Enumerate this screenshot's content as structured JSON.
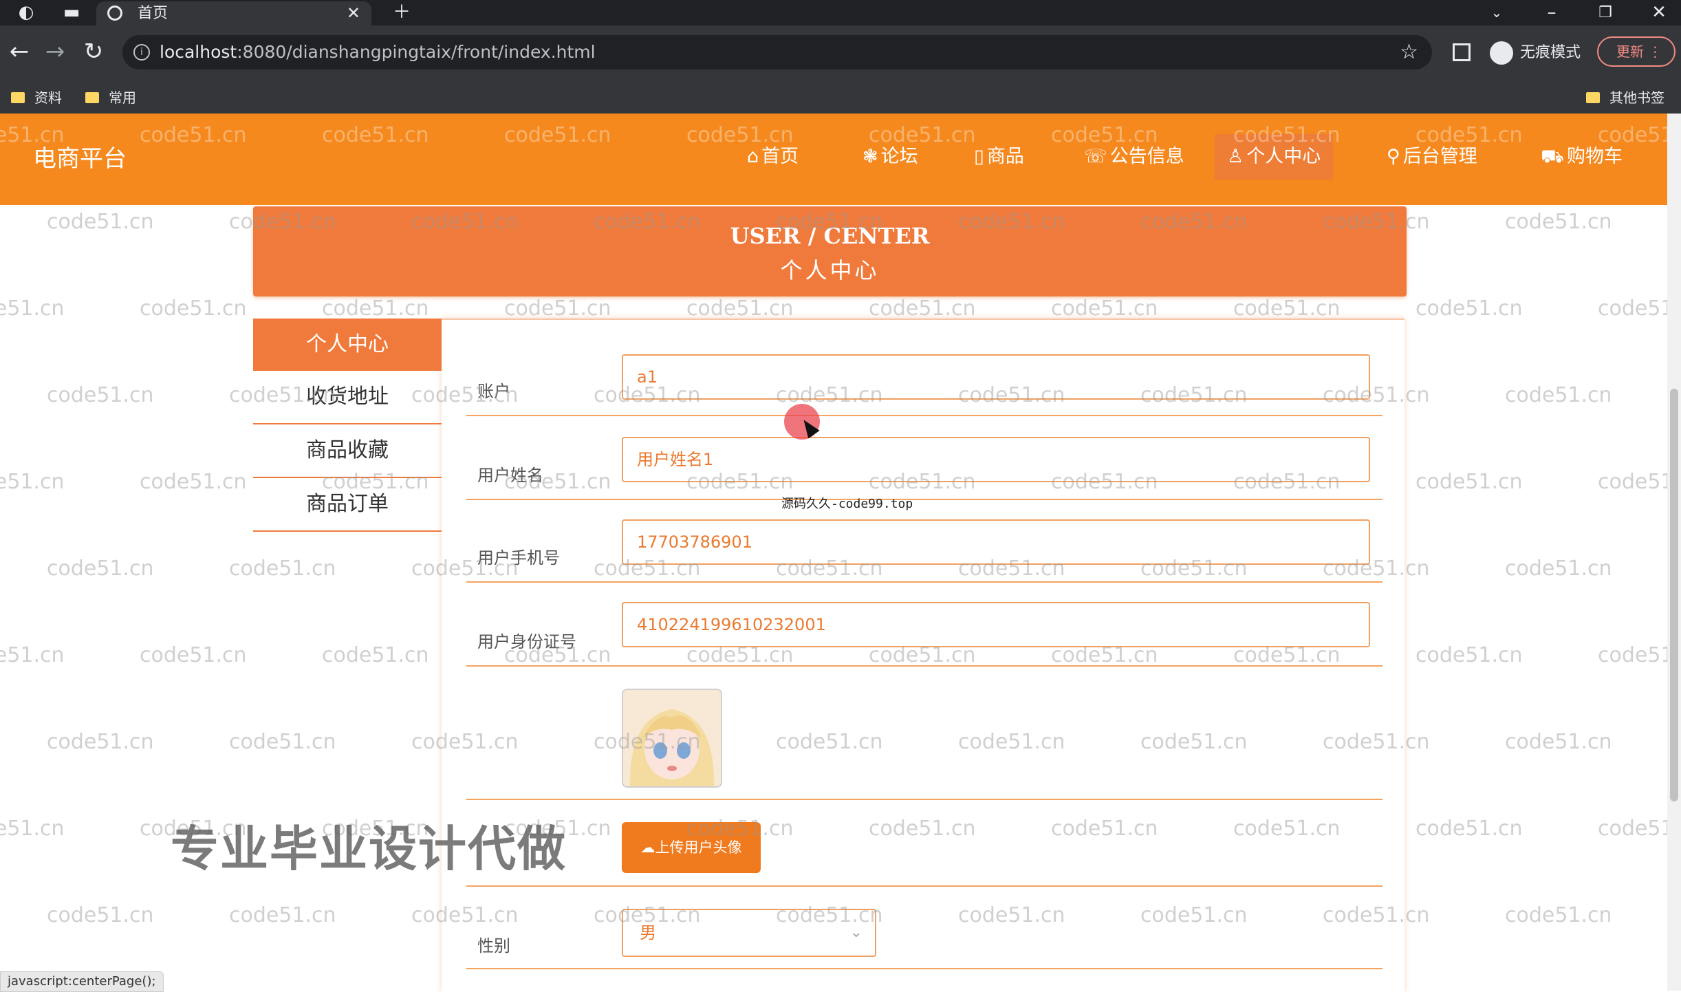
{
  "browser": {
    "tab_title": "首页",
    "url_host": "localhost",
    "url_rest": ":8080/dianshangpingtaix/front/index.html",
    "incognito_label": "无痕模式",
    "update_label": "更新",
    "bookmarks": [
      "资料",
      "常用"
    ],
    "other_bookmarks": "其他书签"
  },
  "site": {
    "brand": "电商平台",
    "nav": [
      {
        "icon": "⌂",
        "label": "首页"
      },
      {
        "icon": "❃",
        "label": "论坛"
      },
      {
        "icon": "▯",
        "label": "商品"
      },
      {
        "icon": "☏",
        "label": "公告信息"
      },
      {
        "icon": "♙",
        "label": "个人中心"
      },
      {
        "icon": "⚲",
        "label": "后台管理"
      },
      {
        "icon": "⛟",
        "label": "购物车"
      }
    ],
    "active_nav": "个人中心"
  },
  "banner": {
    "en": "USER / CENTER",
    "cn": "个人中心"
  },
  "sidemenu": [
    "个人中心",
    "收货地址",
    "商品收藏",
    "商品订单"
  ],
  "form": {
    "fields": [
      {
        "label": "账户",
        "value": "a1"
      },
      {
        "label": "用户姓名",
        "value": "用户姓名1"
      },
      {
        "label": "用户手机号",
        "value": "17703786901"
      },
      {
        "label": "用户身份证号",
        "value": "410224199610232001"
      }
    ],
    "upload_label": "上传用户头像",
    "gender_label": "性别",
    "gender_value": "男"
  },
  "overlay": {
    "tooltip": "源码久久-code99.top",
    "promo": "专业毕业设计代做",
    "status": "javascript:centerPage();",
    "watermark": "code51.cn"
  },
  "colors": {
    "accent": "#f5891e",
    "banner": "#f07a3c"
  }
}
